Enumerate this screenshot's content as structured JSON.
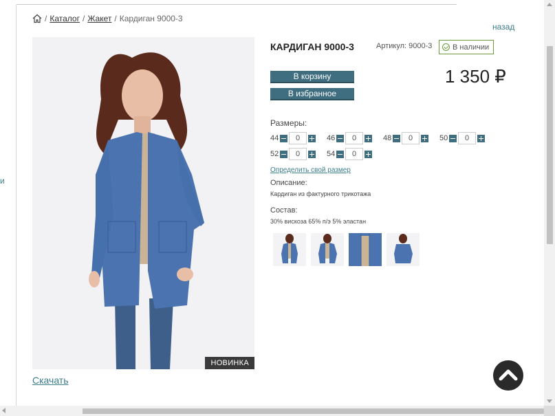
{
  "breadcrumb": {
    "home_icon": "home-icon",
    "items": [
      "Каталог",
      "Жакет"
    ],
    "current": "Кардиган 9000-3",
    "separator": "/"
  },
  "back_label": "назад",
  "edge_letter": "и",
  "product": {
    "title": "КАРДИГАН 9000-3",
    "article": "Артикул: 9000-3",
    "stock": "В наличии",
    "price": "1 350 ₽",
    "badge": "НОВИНКА",
    "download": "Скачать"
  },
  "buttons": {
    "cart": "В корзину",
    "favorite": "В избранное"
  },
  "sizes": {
    "label": "Размеры:",
    "items": [
      {
        "size": "44",
        "qty": "0"
      },
      {
        "size": "46",
        "qty": "0"
      },
      {
        "size": "48",
        "qty": "0"
      },
      {
        "size": "50",
        "qty": "0"
      },
      {
        "size": "52",
        "qty": "0"
      },
      {
        "size": "54",
        "qty": "0"
      }
    ],
    "size_link": "Определить свой размер"
  },
  "description": {
    "label": "Описание:",
    "text": "Кардиган из фактурного трикотажа"
  },
  "composition": {
    "label": "Состав:",
    "text": "30% вискоза 65% п/э 5% эластан"
  },
  "colors": {
    "accent": "#3f6e80",
    "link": "#3c7d8c",
    "stock_border": "#6a9a3a",
    "garment": "#4a73b0"
  }
}
